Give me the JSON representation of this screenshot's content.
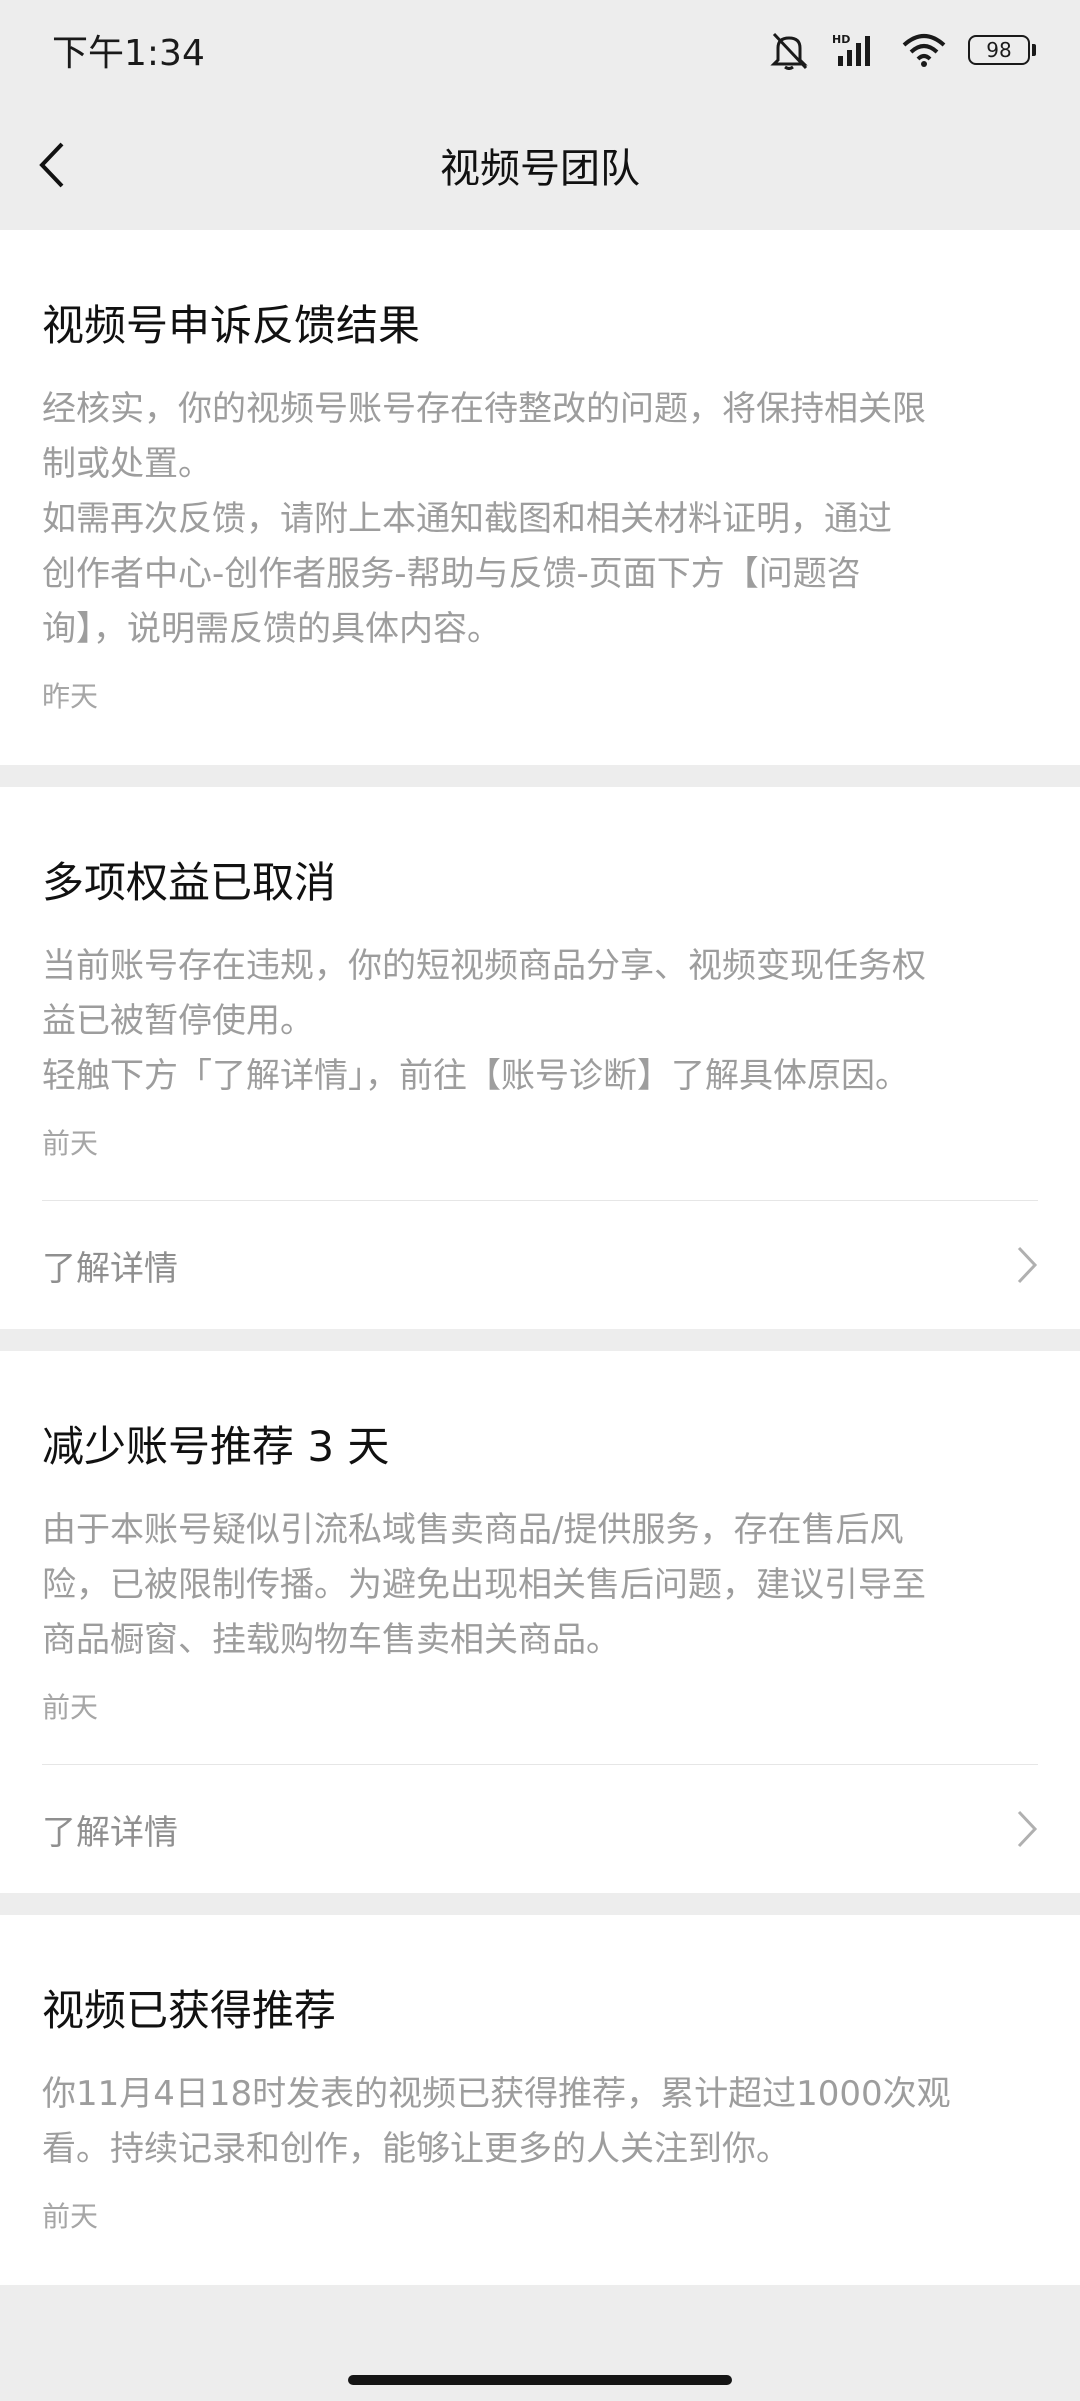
{
  "status": {
    "time": "下午1:34",
    "battery": "98",
    "icons": [
      "bell-muted-icon",
      "hd-signal-icon",
      "wifi-icon",
      "battery-icon"
    ]
  },
  "nav": {
    "title": "视频号团队",
    "back_icon": "chevron-left-icon"
  },
  "messages": [
    {
      "title": "视频号申诉反馈结果",
      "body": "经核实，你的视频号账号存在待整改的问题，将保持相关限\n制或处置。\n如需再次反馈，请附上本通知截图和相关材料证明，通过\n创作者中心-创作者服务-帮助与反馈-页面下方【问题咨\n询】，说明需反馈的具体内容。",
      "date": "昨天"
    },
    {
      "title": "多项权益已取消",
      "body": "当前账号存在违规，你的短视频商品分享、视频变现任务权\n益已被暂停使用。\n轻触下方「了解详情」，前往【账号诊断】了解具体原因。",
      "date": "前天",
      "link": "了解详情"
    },
    {
      "title": "减少账号推荐 3 天",
      "body": "由于本账号疑似引流私域售卖商品/提供服务，存在售后风\n险，已被限制传播。为避免出现相关售后问题，建议引导至\n商品橱窗、挂载购物车售卖相关商品。",
      "date": "前天",
      "link": "了解详情"
    },
    {
      "title": "视频已获得推荐",
      "body": "你11月4日18时发表的视频已获得推荐，累计超过1000次观\n看。持续记录和创作，能够让更多的人关注到你。",
      "date": "前天"
    }
  ]
}
